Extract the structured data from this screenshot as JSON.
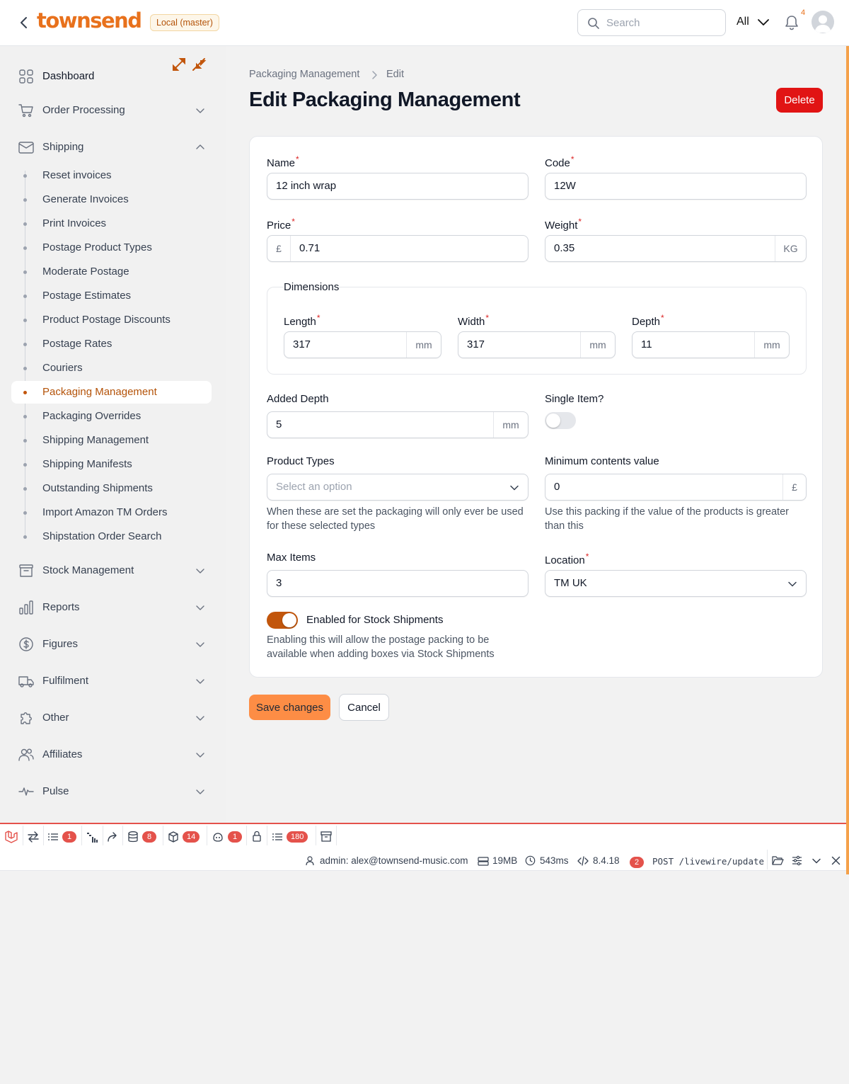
{
  "topbar": {
    "logo": "townsend",
    "environment_badge": "Local (master)",
    "search_placeholder": "Search",
    "scope": "All",
    "notification_count": "4"
  },
  "sidebar": {
    "groups_top": [
      {
        "label": "Dashboard",
        "icon": "dashboard-icon"
      },
      {
        "label": "Order Processing",
        "icon": "cart-icon"
      },
      {
        "label": "Shipping",
        "icon": "envelope-icon"
      }
    ],
    "shipping_items": [
      "Reset invoices",
      "Generate Invoices",
      "Print Invoices",
      "Postage Product Types",
      "Moderate Postage",
      "Postage Estimates",
      "Product Postage Discounts",
      "Postage Rates",
      "Couriers",
      "Packaging Management",
      "Packaging Overrides",
      "Shipping Management",
      "Shipping Manifests",
      "Outstanding Shipments",
      "Import Amazon TM Orders",
      "Shipstation Order Search"
    ],
    "active_item": "Packaging Management",
    "groups_bottom": [
      {
        "label": "Stock Management",
        "icon": "archive-icon"
      },
      {
        "label": "Reports",
        "icon": "bar-chart-icon"
      },
      {
        "label": "Figures",
        "icon": "dollar-icon"
      },
      {
        "label": "Fulfilment",
        "icon": "truck-icon"
      },
      {
        "label": "Other",
        "icon": "puzzle-icon"
      },
      {
        "label": "Affiliates",
        "icon": "users-icon"
      },
      {
        "label": "Pulse",
        "icon": "pulse-icon"
      }
    ]
  },
  "main": {
    "breadcrumb": [
      "Packaging Management",
      "Edit"
    ],
    "title": "Edit Packaging Management",
    "delete_label": "Delete",
    "form": {
      "name_label": "Name",
      "name_value": "12 inch wrap",
      "code_label": "Code",
      "code_value": "12W",
      "price_label": "Price",
      "price_prefix": "£",
      "price_value": "0.71",
      "weight_label": "Weight",
      "weight_value": "0.35",
      "weight_suffix": "KG",
      "dimensions_legend": "Dimensions",
      "length_label": "Length",
      "length_value": "317",
      "width_label": "Width",
      "width_value": "317",
      "depth_label": "Depth",
      "depth_value": "11",
      "unit_mm": "mm",
      "added_depth_label": "Added Depth",
      "added_depth_value": "5",
      "single_item_label": "Single Item?",
      "single_item_on": false,
      "product_types_label": "Product Types",
      "product_types_placeholder": "Select an option",
      "product_types_help": "When these are set the packaging will only ever be used for these selected types",
      "min_value_label": "Minimum contents value",
      "min_value_value": "0",
      "min_value_suffix": "£",
      "min_value_help": "Use this packing if the value of the products is greater than this",
      "max_items_label": "Max Items",
      "max_items_value": "3",
      "location_label": "Location",
      "location_value": "TM UK",
      "stock_shipments_label": "Enabled for Stock Shipments",
      "stock_shipments_on": true,
      "stock_shipments_help": "Enabling this will allow the postage packing to be available when adding boxes via Stock Shipments"
    },
    "save_label": "Save changes",
    "cancel_label": "Cancel"
  },
  "debugbar": {
    "badges": {
      "messages": "1",
      "queries": "8",
      "models": "14",
      "gate": "1",
      "events": "180"
    },
    "user": "admin: alex@townsend-music.com",
    "memory": "19MB",
    "time": "543ms",
    "php_version": "8.4.18",
    "request_count": "2",
    "request": "POST /livewire/update"
  },
  "colors": {
    "accent": "#e8711c",
    "active_text": "#b45309",
    "danger": "#e11414",
    "save_button": "#fd8d45"
  }
}
